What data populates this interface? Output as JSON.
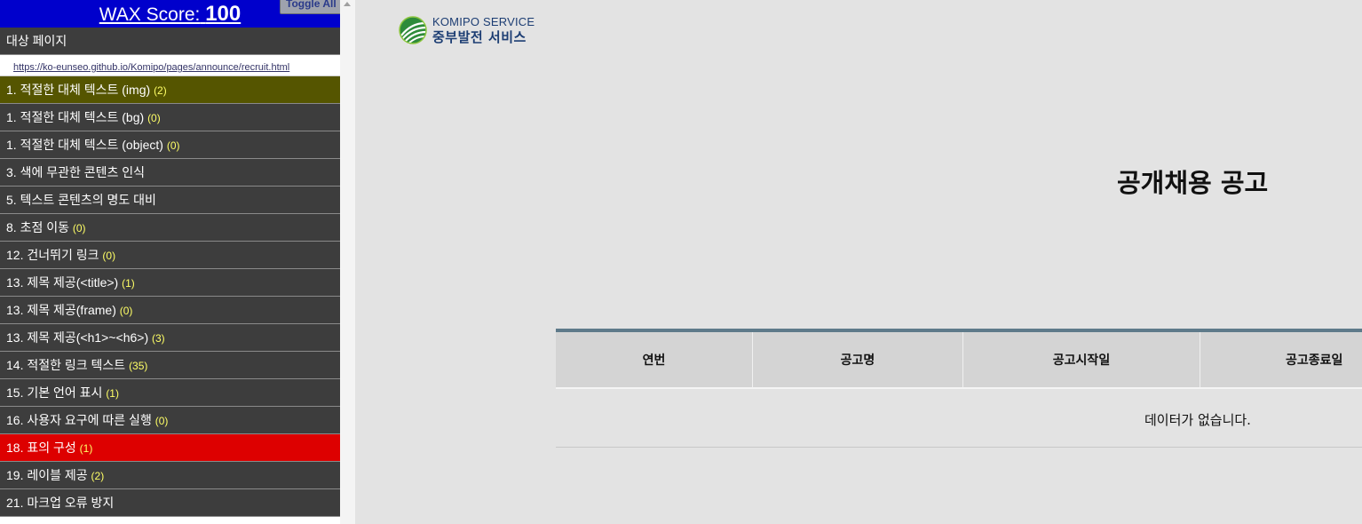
{
  "wax": {
    "score_label": "WAX Score:",
    "score_value": "100",
    "toggle_label": "Toggle All",
    "target_page_label": "대상 페이지",
    "target_url": "https://ko-eunseo.github.io/Komipo/pages/announce/recruit.html",
    "items": [
      {
        "label": "1. 적절한 대체 텍스트 (img)",
        "count": "(2)",
        "status": "warning"
      },
      {
        "label": "1. 적절한 대체 텍스트 (bg)",
        "count": "(0)",
        "status": "normal"
      },
      {
        "label": "1. 적절한 대체 텍스트 (object)",
        "count": "(0)",
        "status": "normal"
      },
      {
        "label": "3. 색에 무관한 콘텐츠 인식",
        "count": "",
        "status": "normal"
      },
      {
        "label": "5. 텍스트 콘텐츠의 명도 대비",
        "count": "",
        "status": "normal"
      },
      {
        "label": "8. 초점 이동",
        "count": "(0)",
        "status": "normal"
      },
      {
        "label": "12. 건너뛰기 링크",
        "count": "(0)",
        "status": "normal"
      },
      {
        "label": "13. 제목 제공(<title>)",
        "count": "(1)",
        "status": "normal"
      },
      {
        "label": "13. 제목 제공(frame)",
        "count": "(0)",
        "status": "normal"
      },
      {
        "label": "13. 제목 제공(<h1>~<h6>)",
        "count": "(3)",
        "status": "normal"
      },
      {
        "label": "14. 적절한 링크 텍스트",
        "count": "(35)",
        "status": "normal"
      },
      {
        "label": "15. 기본 언어 표시",
        "count": "(1)",
        "status": "normal"
      },
      {
        "label": "16. 사용자 요구에 따른 실행",
        "count": "(0)",
        "status": "normal"
      },
      {
        "label": "18. 표의 구성",
        "count": "(1)",
        "status": "error"
      },
      {
        "label": "19. 레이블 제공",
        "count": "(2)",
        "status": "normal"
      },
      {
        "label": "21. 마크업 오류 방지",
        "count": "",
        "status": "normal"
      }
    ],
    "colors": {
      "header": "#0000cc",
      "row": "#3d3d3d",
      "warning": "#555500",
      "error": "#dd0000",
      "count": "#ffff66"
    }
  },
  "page": {
    "logo_en": "KOMIPO SERVICE",
    "logo_ko": "중부발전 서비스",
    "logo_icon": "komipo-leaf-logo-icon",
    "title": "공개채용 공고",
    "table": {
      "headers": [
        "연번",
        "공고명",
        "공고시작일",
        "공고종료일"
      ],
      "empty_message": "데이터가 없습니다."
    }
  }
}
